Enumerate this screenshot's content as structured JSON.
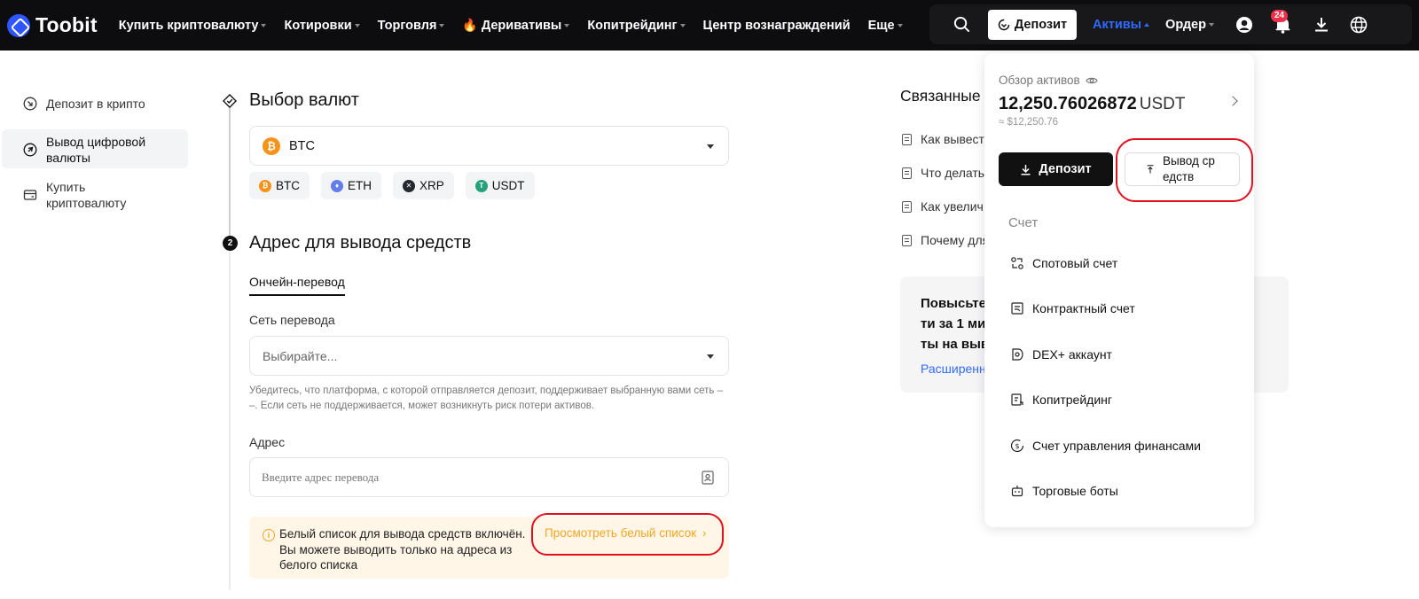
{
  "brand": {
    "name": "Toobit"
  },
  "nav": {
    "items": [
      {
        "label": "Купить криптовалюту",
        "caret": true,
        "fire": false
      },
      {
        "label": "Котировки",
        "caret": true,
        "fire": false
      },
      {
        "label": "Торговля",
        "caret": true,
        "fire": false
      },
      {
        "label": "Деривативы",
        "caret": true,
        "fire": true
      },
      {
        "label": "Копитрейдинг",
        "caret": true,
        "fire": false
      },
      {
        "label": "Центр вознаграждений",
        "caret": false,
        "fire": false
      },
      {
        "label": "Еще",
        "caret": true,
        "fire": false
      }
    ],
    "deposit_label": "Депозит",
    "assets_label": "Активы",
    "orders_label": "Ордер",
    "notification_count": "24"
  },
  "sidebar": {
    "items": [
      {
        "label": "Депозит в крипто",
        "icon": "deposit-icon"
      },
      {
        "label": "Вывод цифровой валюты",
        "icon": "withdraw-icon"
      },
      {
        "label": "Купить криптовалюту",
        "icon": "card-icon"
      }
    ]
  },
  "main": {
    "step1_title": "Выбор валют",
    "currency_selected": "BTC",
    "chips": [
      {
        "label": "BTC",
        "color": "#f7931a",
        "glyph": "₿"
      },
      {
        "label": "ETH",
        "color": "#627eea",
        "glyph": "♦"
      },
      {
        "label": "XRP",
        "color": "#23292f",
        "glyph": "✕"
      },
      {
        "label": "USDT",
        "color": "#26a17b",
        "glyph": "T"
      }
    ],
    "step2_title": "Адрес для вывода средств",
    "tab_onchain": "Ончейн-перевод",
    "network_label": "Сеть перевода",
    "network_placeholder": "Выбирайте...",
    "network_hint": "Убедитесь, что платформа, с которой отправляется депозит, поддерживает выбранную вами сеть –\n–. Если сеть не поддерживается, может возникнуть риск потери активов.",
    "address_label": "Адрес",
    "address_placeholder": "Введите адрес перевода",
    "whitelist_text": "Белый список для вывода средств включён. Вы можете выводить только на адреса из белого списка",
    "whitelist_link": "Просмотреть белый список"
  },
  "related": {
    "title": "Связанные",
    "items": [
      "Как вывест",
      "Что делать",
      "Как увелич",
      "Почему для"
    ],
    "promo_text": "Повысьте ти за 1 ми ты на выв",
    "promo_link": "Расширенн"
  },
  "assets_dropdown": {
    "overview_label": "Обзор активов",
    "balance": "12,250.76026872",
    "balance_unit": "USDT",
    "balance_approx": "≈ $12,250.76",
    "deposit_label": "Депозит",
    "withdraw_label": "Вывод средств",
    "section_label": "Счет",
    "accounts": [
      {
        "label": "Спотовый счет",
        "icon": "spot-icon"
      },
      {
        "label": "Контрактный счет",
        "icon": "contract-icon"
      },
      {
        "label": "DEX+ аккаунт",
        "icon": "dex-icon"
      },
      {
        "label": "Копитрейдинг",
        "icon": "copytrade-icon"
      },
      {
        "label": "Счет управления финансами",
        "icon": "finance-icon"
      },
      {
        "label": "Торговые боты",
        "icon": "bot-icon"
      }
    ]
  },
  "colors": {
    "accent_blue": "#2f6bff",
    "annotation_red": "#e0101e",
    "warning_orange": "#f5a623"
  }
}
